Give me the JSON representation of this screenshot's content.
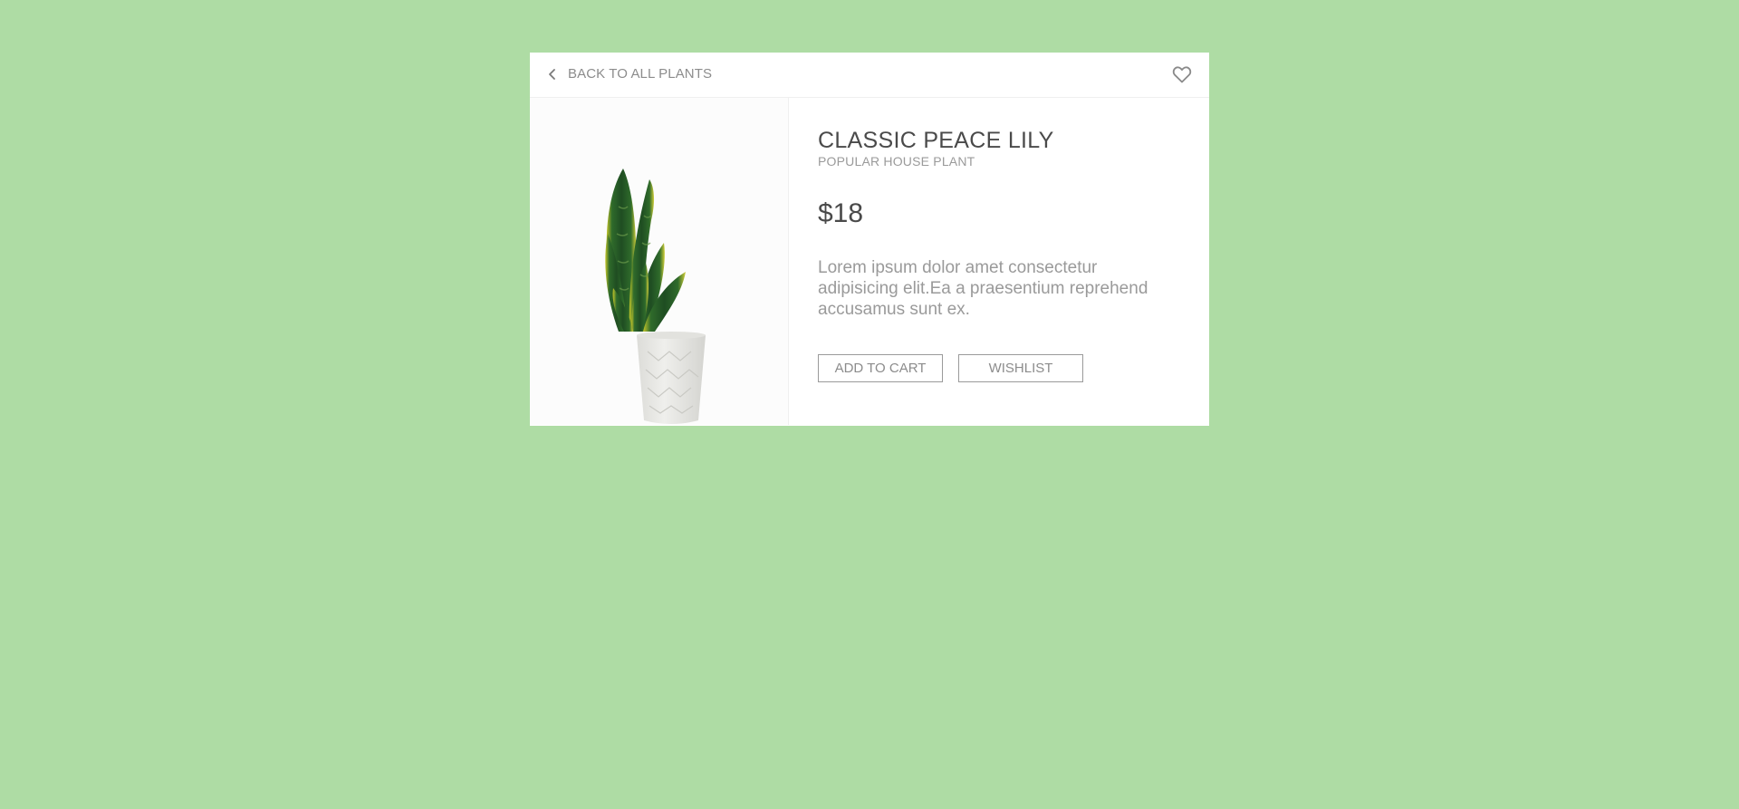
{
  "header": {
    "back_label": "BACK TO ALL PLANTS",
    "back_icon": "chevron-left-icon",
    "favorite_icon": "heart-icon"
  },
  "product": {
    "title": "CLASSIC PEACE LILY",
    "subtitle": "POPULAR HOUSE PLANT",
    "price": "$18",
    "description": "Lorem ipsum dolor amet consectetur adipisicing elit.Ea a praesentium reprehend accusamus sunt ex.",
    "image": "snake-plant-in-white-pot"
  },
  "actions": {
    "add_to_cart_label": "ADD TO CART",
    "wishlist_label": "WISHLIST"
  },
  "colors": {
    "background": "#aedca4",
    "card": "#ffffff",
    "text_dark": "#4a4a4a",
    "text_muted": "#9a9a9a"
  }
}
